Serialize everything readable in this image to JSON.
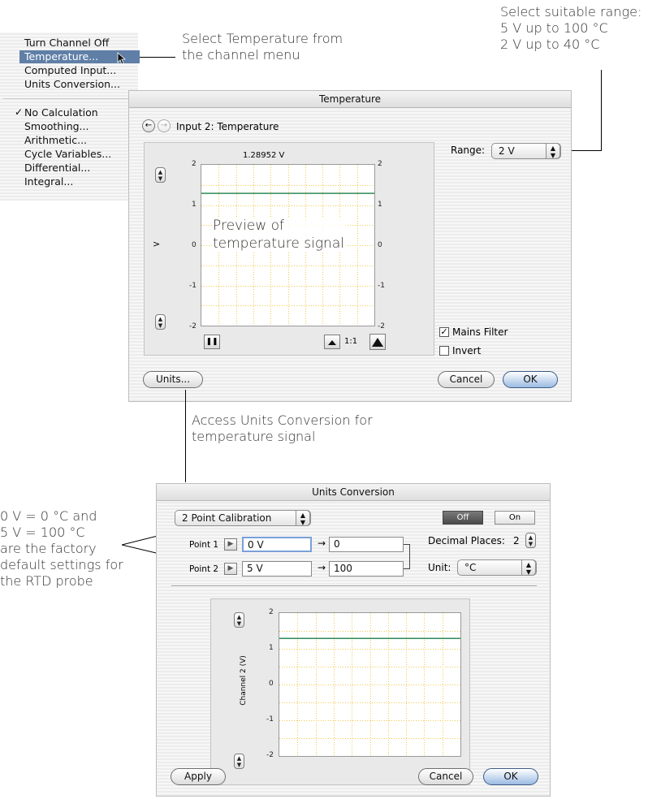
{
  "channel_menu": {
    "items": [
      "Turn Channel Off",
      "Temperature...",
      "Computed Input...",
      "Units Conversion..."
    ],
    "calc_items": [
      "No Calculation",
      "Smoothing...",
      "Arithmetic...",
      "Cycle Variables...",
      "Differential...",
      "Integral..."
    ],
    "checkmark": "✓",
    "selected": "Temperature..."
  },
  "callouts": {
    "select_temp": [
      "Select Temperature from",
      "the channel menu"
    ],
    "range_hint": [
      "Select suitable range:",
      "5 V up to 100 °C",
      "2 V up to 40 °C"
    ],
    "preview": [
      "Preview of",
      "temperature signal"
    ],
    "units_access": [
      "Access Units Conversion for",
      "temperature signal"
    ],
    "factory": [
      "0 V = 0 °C and",
      "5 V = 100 °C",
      "are the factory",
      "default settings for",
      "the RTD probe"
    ]
  },
  "temperature_dialog": {
    "title": "Temperature",
    "input_label": "Input 2: Temperature",
    "readout": "1.28952 V",
    "range_label": "Range:",
    "range_value": "2 V",
    "y_ticks_left": [
      "2",
      "1",
      "0",
      "-1",
      "-2"
    ],
    "y_ticks_right": [
      "2",
      "1",
      "0",
      "-1",
      "-2"
    ],
    "scale_label": "1:1",
    "mains_filter_label": "Mains Filter",
    "mains_filter_checked": true,
    "invert_label": "Invert",
    "invert_checked": false,
    "units_button": "Units...",
    "cancel_button": "Cancel",
    "ok_button": "OK",
    "pause_icon": "❚❚",
    "back_icon": "←",
    "forward_icon": "→",
    "side_marker": ">",
    "signal_level_v": 1.29,
    "y_range": [
      -2,
      2
    ]
  },
  "units_dialog": {
    "title": "Units Conversion",
    "mode": "2 Point Calibration",
    "off_label": "Off",
    "on_label": "On",
    "point1_label": "Point 1",
    "point1_input": "0 V",
    "point1_output": "0",
    "point2_label": "Point 2",
    "point2_input": "5 V",
    "point2_output": "100",
    "arrow": "→",
    "decimal_label": "Decimal Places:",
    "decimal_value": "2",
    "unit_label": "Unit:",
    "unit_value": "°C",
    "y_axis_label": "Channel 2 (V)",
    "y_ticks": [
      "2",
      "1",
      "0",
      "-1",
      "-2"
    ],
    "apply_button": "Apply",
    "cancel_button": "Cancel",
    "ok_button": "OK",
    "signal_level_v": 1.29,
    "y_range": [
      -2,
      2
    ]
  },
  "colors": {
    "grid": "#f2c94c",
    "signal": "#2e8b57",
    "menu_highlight": "#5f7fa7"
  }
}
